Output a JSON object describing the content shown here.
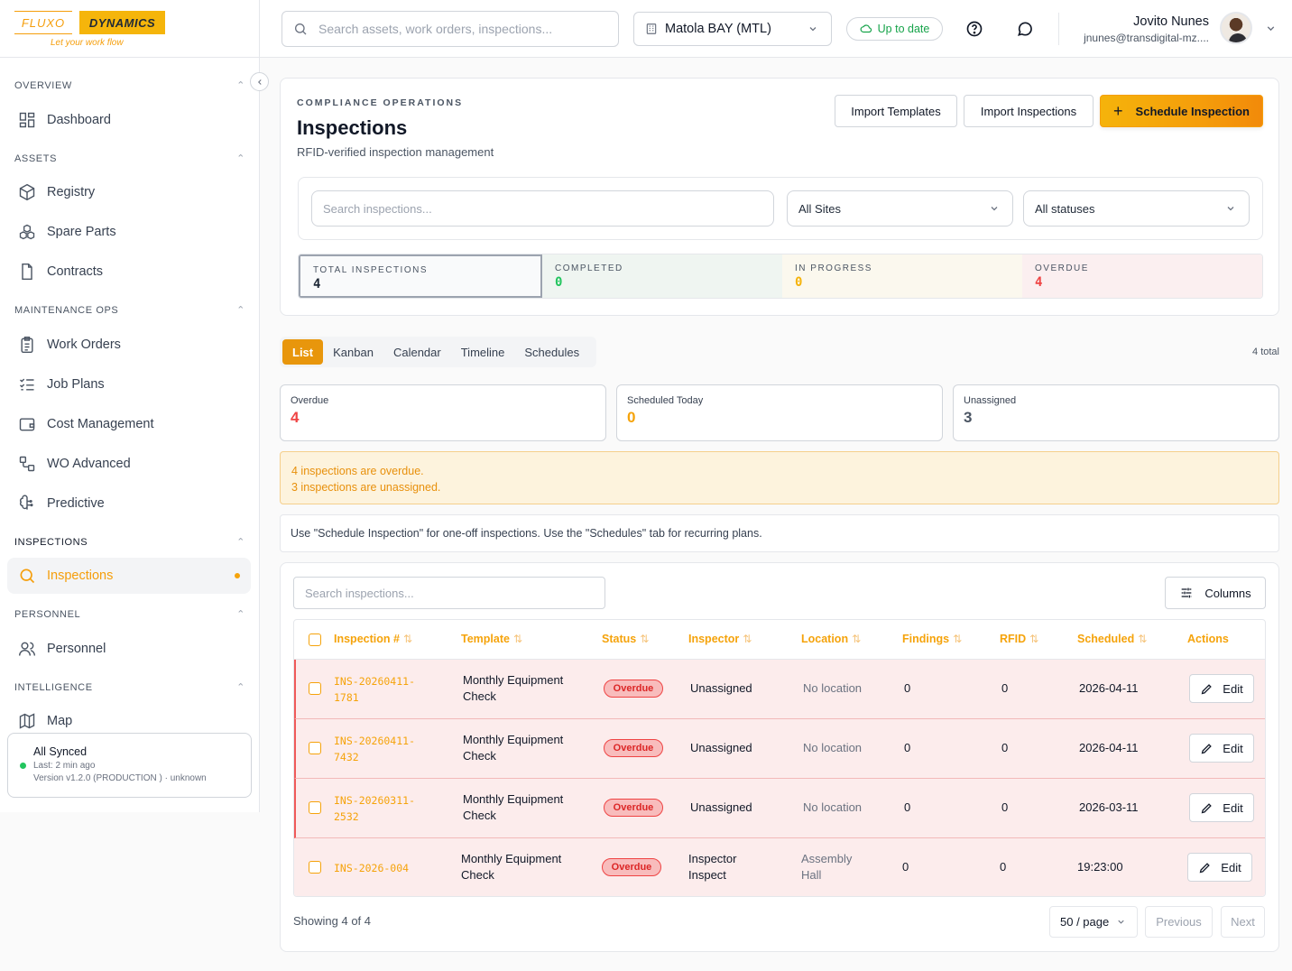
{
  "brand": {
    "part1": "FLUXO",
    "part2": "DYNAMICS",
    "tagline": "Let your work flow"
  },
  "sidebar": {
    "sections": [
      {
        "title": "OVERVIEW",
        "items": [
          {
            "label": "Dashboard",
            "icon": "grid-icon"
          }
        ]
      },
      {
        "title": "ASSETS",
        "items": [
          {
            "label": "Registry",
            "icon": "cube-icon"
          },
          {
            "label": "Spare Parts",
            "icon": "boxes-icon"
          },
          {
            "label": "Contracts",
            "icon": "file-icon"
          }
        ]
      },
      {
        "title": "MAINTENANCE OPS",
        "items": [
          {
            "label": "Work Orders",
            "icon": "clipboard-icon"
          },
          {
            "label": "Job Plans",
            "icon": "list-check-icon"
          },
          {
            "label": "Cost Management",
            "icon": "wallet-icon"
          },
          {
            "label": "WO Advanced",
            "icon": "workflow-icon"
          },
          {
            "label": "Predictive",
            "icon": "brain-icon"
          }
        ]
      },
      {
        "title": "INSPECTIONS",
        "items": [
          {
            "label": "Inspections",
            "icon": "search-icon",
            "active": true
          }
        ]
      },
      {
        "title": "PERSONNEL",
        "items": [
          {
            "label": "Personnel",
            "icon": "users-icon"
          }
        ]
      },
      {
        "title": "INTELLIGENCE",
        "items": [
          {
            "label": "Map",
            "icon": "map-icon"
          }
        ]
      }
    ],
    "sync": {
      "title": "All Synced",
      "last": "Last: 2 min ago",
      "version": "Version v1.2.0 (PRODUCTION ) · unknown"
    }
  },
  "topbar": {
    "search_placeholder": "Search assets, work orders, inspections...",
    "site": "Matola BAY (MTL)",
    "status": "Up to date",
    "user_name": "Jovito Nunes",
    "user_email": "jnunes@transdigital-mz...."
  },
  "header": {
    "eyebrow": "COMPLIANCE OPERATIONS",
    "title": "Inspections",
    "subtitle": "RFID-verified inspection management",
    "import_templates": "Import Templates",
    "import_inspections": "Import Inspections",
    "schedule": "Schedule Inspection",
    "filter_search_placeholder": "Search inspections...",
    "filter_site": "All Sites",
    "filter_status": "All statuses"
  },
  "stats": {
    "total_label": "TOTAL INSPECTIONS",
    "total": "4",
    "completed_label": "COMPLETED",
    "completed": "0",
    "in_progress_label": "IN PROGRESS",
    "in_progress": "0",
    "overdue_label": "OVERDUE",
    "overdue": "4"
  },
  "tabs": [
    "List",
    "Kanban",
    "Calendar",
    "Timeline",
    "Schedules"
  ],
  "active_tab": "List",
  "total_count": "4 total",
  "kpis": [
    {
      "label": "Overdue",
      "value": "4",
      "color": "#ef4444"
    },
    {
      "label": "Scheduled Today",
      "value": "0",
      "color": "#f5a30b"
    },
    {
      "label": "Unassigned",
      "value": "3",
      "color": "#4b5563"
    }
  ],
  "alerts": [
    "4 inspections are overdue.",
    "3 inspections are unassigned."
  ],
  "note": "Use \"Schedule Inspection\" for one-off inspections. Use the \"Schedules\" tab for recurring plans.",
  "table": {
    "search_placeholder": "Search inspections...",
    "columns_label": "Columns",
    "headers": [
      "Inspection #",
      "Template",
      "Status",
      "Inspector",
      "Location",
      "Findings",
      "RFID",
      "Scheduled",
      "Actions"
    ],
    "rows": [
      {
        "id_1": "INS-20260411-",
        "id_2": "1781",
        "template_1": "Monthly Equipment",
        "template_2": "Check",
        "status": "Overdue",
        "inspector_1": "Unassigned",
        "inspector_2": "",
        "location_1": "No location",
        "location_2": "",
        "findings": "0",
        "rfid": "0",
        "scheduled": "2026-04-11",
        "action": "Edit"
      },
      {
        "id_1": "INS-20260411-",
        "id_2": "7432",
        "template_1": "Monthly Equipment",
        "template_2": "Check",
        "status": "Overdue",
        "inspector_1": "Unassigned",
        "inspector_2": "",
        "location_1": "No location",
        "location_2": "",
        "findings": "0",
        "rfid": "0",
        "scheduled": "2026-04-11",
        "action": "Edit"
      },
      {
        "id_1": "INS-20260311-",
        "id_2": "2532",
        "template_1": "Monthly Equipment",
        "template_2": "Check",
        "status": "Overdue",
        "inspector_1": "Unassigned",
        "inspector_2": "",
        "location_1": "No location",
        "location_2": "",
        "findings": "0",
        "rfid": "0",
        "scheduled": "2026-03-11",
        "action": "Edit"
      },
      {
        "id_1": "INS-2026-004",
        "id_2": "",
        "template_1": "Monthly Equipment",
        "template_2": "Check",
        "status": "Overdue",
        "inspector_1": "Inspector",
        "inspector_2": "Inspect",
        "location_1": "Assembly",
        "location_2": "Hall",
        "findings": "0",
        "rfid": "0",
        "scheduled": "19:23:00",
        "action": "Edit"
      }
    ],
    "showing": "Showing 4 of 4",
    "page_size": "50 / page",
    "previous": "Previous",
    "next": "Next"
  }
}
